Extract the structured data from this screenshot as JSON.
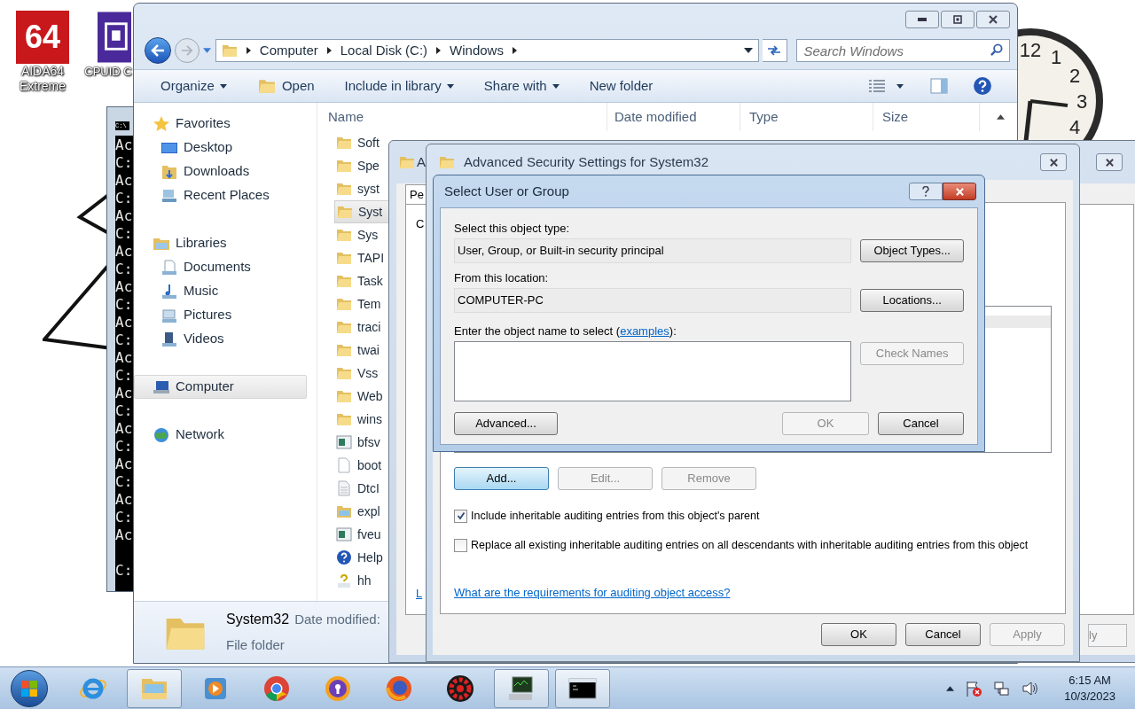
{
  "desktop": {
    "icons": [
      {
        "label": "AIDA64 Extreme",
        "kind": "aida",
        "logo_text": "64"
      },
      {
        "label": "CPUID C",
        "kind": "cpuid"
      }
    ],
    "clock": {
      "numerals": [
        "12",
        "1",
        "2",
        "3",
        "4"
      ]
    }
  },
  "console": {
    "title_icon": "C:\\",
    "lines": [
      "Ac",
      "C:",
      "Ac",
      "C:",
      "Ac",
      "C:",
      "Ac",
      "C:",
      "Ac",
      "C:",
      "Ac",
      "C:",
      "Ac",
      "C:",
      "Ac",
      "C:",
      "Ac",
      "C:",
      "Ac",
      "C:",
      "Ac",
      "C:",
      "Ac"
    ],
    "final_line": "C:"
  },
  "explorer": {
    "breadcrumbs": [
      "Computer",
      "Local Disk (C:)",
      "Windows"
    ],
    "search": {
      "placeholder": "Search Windows"
    },
    "toolbar": [
      {
        "label": "Organize",
        "kind": "menu"
      },
      {
        "label": "Open",
        "kind": "open"
      },
      {
        "label": "Include in library",
        "kind": "menu"
      },
      {
        "label": "Share with",
        "kind": "menu"
      },
      {
        "label": "New folder",
        "kind": "plain"
      }
    ],
    "nav": [
      {
        "label": "Favorites",
        "kind": "favorites",
        "selected": false,
        "children": [
          {
            "label": "Desktop",
            "kind": "desktop",
            "selected": false
          },
          {
            "label": "Downloads",
            "kind": "downloads",
            "selected": false
          },
          {
            "label": "Recent Places",
            "kind": "recent",
            "selected": false
          }
        ]
      },
      {
        "label": "Libraries",
        "kind": "libraries",
        "selected": false,
        "children": [
          {
            "label": "Documents",
            "kind": "documents",
            "selected": false
          },
          {
            "label": "Music",
            "kind": "music",
            "selected": false
          },
          {
            "label": "Pictures",
            "kind": "pictures",
            "selected": false
          },
          {
            "label": "Videos",
            "kind": "videos",
            "selected": false
          }
        ]
      },
      {
        "label": "Computer",
        "kind": "computer",
        "selected": true
      },
      {
        "label": "Network",
        "kind": "network",
        "selected": false
      }
    ],
    "columns": [
      "Name",
      "Date modified",
      "Type",
      "Size"
    ],
    "files": [
      {
        "name": "Soft",
        "kind": "folder",
        "selected": false
      },
      {
        "name": "Spe",
        "kind": "folder",
        "selected": false
      },
      {
        "name": "syst",
        "kind": "folder",
        "selected": false
      },
      {
        "name": "Syst",
        "kind": "folder",
        "selected": true
      },
      {
        "name": "Sys",
        "kind": "folder",
        "selected": false
      },
      {
        "name": "TAPI",
        "kind": "folder",
        "selected": false
      },
      {
        "name": "Task",
        "kind": "folder",
        "selected": false
      },
      {
        "name": "Tem",
        "kind": "folder",
        "selected": false
      },
      {
        "name": "traci",
        "kind": "folder",
        "selected": false
      },
      {
        "name": "twai",
        "kind": "folder",
        "selected": false
      },
      {
        "name": "Vss",
        "kind": "folder",
        "selected": false
      },
      {
        "name": "Web",
        "kind": "folder",
        "selected": false
      },
      {
        "name": "wins",
        "kind": "folder",
        "selected": false
      },
      {
        "name": "bfsv",
        "kind": "app",
        "selected": false
      },
      {
        "name": "boot",
        "kind": "file",
        "selected": false
      },
      {
        "name": "DtcI",
        "kind": "text",
        "selected": false
      },
      {
        "name": "expl",
        "kind": "explorer",
        "selected": false
      },
      {
        "name": "fveu",
        "kind": "app",
        "selected": false
      },
      {
        "name": "Help",
        "kind": "help",
        "selected": false
      },
      {
        "name": "hh",
        "kind": "helpfile",
        "selected": false
      }
    ],
    "details": {
      "name": "System32",
      "meta": "Date modified:",
      "type": "File folder"
    }
  },
  "back_window": {
    "title": "A",
    "tab": "Pe",
    "fragment": "C",
    "link": "L",
    "button": "ly"
  },
  "advanced": {
    "title": "Advanced Security Settings for System32",
    "entry_buttons": [
      {
        "label": "Add...",
        "disabled": false,
        "focused": true
      },
      {
        "label": "Edit...",
        "disabled": true,
        "focused": false
      },
      {
        "label": "Remove",
        "disabled": true,
        "focused": false
      }
    ],
    "checkboxes": [
      {
        "label": "Include inheritable auditing entries from this object's parent",
        "checked": true
      },
      {
        "label": "Replace all existing inheritable auditing entries on all descendants with inheritable auditing entries from this object",
        "checked": false
      }
    ],
    "link": "What are the requirements for auditing object access?",
    "buttons": [
      {
        "label": "OK",
        "disabled": false
      },
      {
        "label": "Cancel",
        "disabled": false
      },
      {
        "label": "Apply",
        "disabled": true
      }
    ]
  },
  "select_dialog": {
    "title": "Select User or Group",
    "fields": [
      {
        "label": "Select this object type:",
        "value": "User, Group, or Built-in security principal",
        "button": "Object Types..."
      },
      {
        "label": "From this location:",
        "value": "COMPUTER-PC",
        "button": "Locations..."
      }
    ],
    "name_label": {
      "before": "Enter the object name to select (",
      "link": "examples",
      "after": "):"
    },
    "check_names": {
      "label": "Check Names",
      "disabled": true
    },
    "advanced_button": {
      "label": "Advanced...",
      "disabled": false
    },
    "buttons": [
      {
        "label": "OK",
        "disabled": true
      },
      {
        "label": "Cancel",
        "disabled": false
      }
    ]
  },
  "taskbar": {
    "items": [
      {
        "kind": "ie",
        "active": false
      },
      {
        "kind": "explorer",
        "active": true
      },
      {
        "kind": "player",
        "active": false
      },
      {
        "kind": "chrome",
        "active": false
      },
      {
        "kind": "lock",
        "active": false
      },
      {
        "kind": "firefox",
        "active": false
      },
      {
        "kind": "gear",
        "active": false
      },
      {
        "kind": "monitor",
        "active": true
      },
      {
        "kind": "console",
        "active": true
      }
    ],
    "time": "6:15 AM",
    "date": "10/3/2023"
  }
}
